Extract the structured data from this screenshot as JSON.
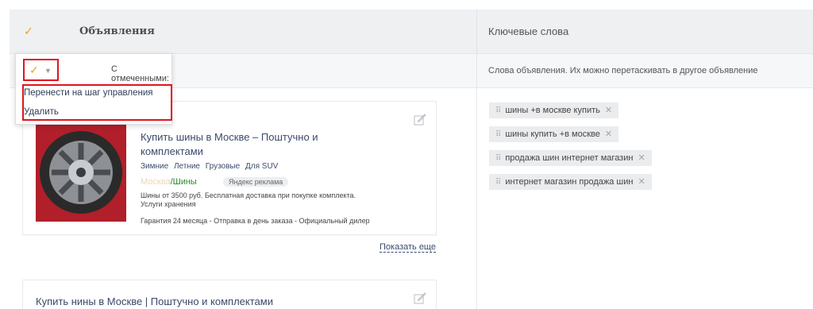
{
  "header": {
    "ads_title": "Объявления",
    "keywords_title": "Ключевые слова"
  },
  "subbar": {
    "keywords_hint": "Слова объявления. Их можно перетаскивать в другое объявление"
  },
  "bulk_menu": {
    "label": "С отмеченными:",
    "items": [
      "Перенести на шаг управления",
      "Удалить"
    ]
  },
  "ads": [
    {
      "title": "Купить шины в Москве – Поштучно и комплектами",
      "sitelinks": [
        "Зимние",
        "Летние",
        "Грузовые",
        "Для SUV"
      ],
      "url_faded": "Москва",
      "url_path": "/Шины",
      "badge": "Яндекс реклама",
      "desc": "Шины от 3500 руб. Бесплатная доставка при покупке комплекта. Услуги хранения",
      "desc2": "Гарантия 24 месяца - Отправка в день заказа - Официальный дилер"
    },
    {
      "title": "Купить нины в Москве | Поштучно и комплектами"
    }
  ],
  "show_more": "Показать еще",
  "keywords": [
    "шины +в москве купить",
    "шины купить +в москве",
    "продажа шин интернет магазин",
    "интернет магазин продажа шин"
  ],
  "colors": {
    "accent_check": "#f0a020",
    "highlight": "#e0141e",
    "link": "#3a4a6b",
    "url_green": "#2a8a2a"
  }
}
